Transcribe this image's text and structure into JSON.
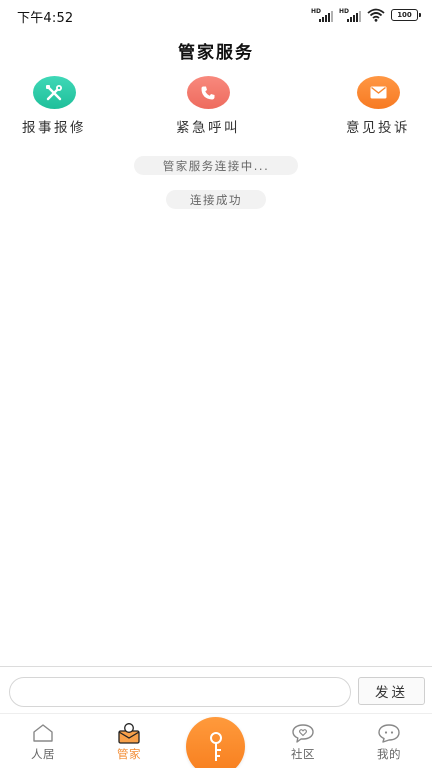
{
  "status_bar": {
    "time": "下午4:52",
    "battery": "100",
    "signal_label": "HD"
  },
  "header": {
    "title": "管家服务"
  },
  "actions": [
    {
      "label": "报事报修",
      "icon": "wrench-screwdriver-icon",
      "color": "#2bcba8"
    },
    {
      "label": "紧急呼叫",
      "icon": "phone-icon",
      "color": "#f27a6d"
    },
    {
      "label": "意见投诉",
      "icon": "envelope-icon",
      "color": "#f7862e"
    }
  ],
  "messages": [
    {
      "text": "管家服务连接中..."
    },
    {
      "text": "连接成功"
    }
  ],
  "composer": {
    "placeholder": "",
    "value": "",
    "send_label": "发送"
  },
  "tabs": [
    {
      "label": "人居",
      "icon": "house-icon",
      "active": false
    },
    {
      "label": "管家",
      "icon": "butler-icon",
      "active": true
    },
    {
      "label": "",
      "icon": "key-icon",
      "active": false
    },
    {
      "label": "社区",
      "icon": "chat-heart-icon",
      "active": false
    },
    {
      "label": "我的",
      "icon": "smile-chat-icon",
      "active": false
    }
  ],
  "colors": {
    "accent": "#f28a30",
    "text": "#333333"
  }
}
